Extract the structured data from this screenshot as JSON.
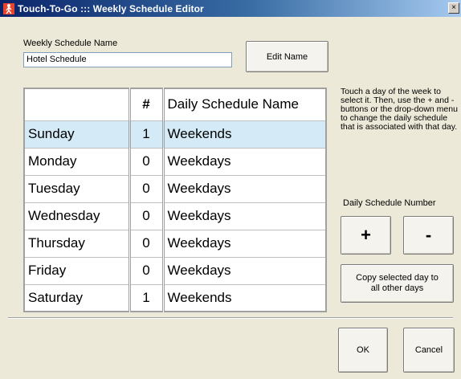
{
  "window": {
    "title": "Touch-To-Go ::: Weekly Schedule Editor",
    "close_glyph": "×"
  },
  "weekly_name": {
    "label": "Weekly Schedule Name",
    "value": "Hotel Schedule",
    "edit_button": "Edit Name"
  },
  "table": {
    "headers": [
      "",
      "#",
      "Daily Schedule Name"
    ],
    "rows": [
      {
        "day": "Sunday",
        "num": "1",
        "name": "Weekends",
        "selected": true
      },
      {
        "day": "Monday",
        "num": "0",
        "name": "Weekdays",
        "selected": false
      },
      {
        "day": "Tuesday",
        "num": "0",
        "name": "Weekdays",
        "selected": false
      },
      {
        "day": "Wednesday",
        "num": "0",
        "name": "Weekdays",
        "selected": false
      },
      {
        "day": "Thursday",
        "num": "0",
        "name": "Weekdays",
        "selected": false
      },
      {
        "day": "Friday",
        "num": "0",
        "name": "Weekdays",
        "selected": false
      },
      {
        "day": "Saturday",
        "num": "1",
        "name": "Weekends",
        "selected": false
      }
    ]
  },
  "help_text": "Touch a day of the week to select it.  Then, use the + and - buttons or the drop-down menu to change the daily schedule that is associated with that day.",
  "number_controls": {
    "label": "Daily Schedule Number",
    "plus": "+",
    "minus": "-"
  },
  "copy_button": "Copy selected day to all other days",
  "ok_button": "OK",
  "cancel_button": "Cancel",
  "colors": {
    "title_gradient_start": "#0a246a",
    "selected_row": "#d4ebf7",
    "dialog_bg": "#ece9d8"
  }
}
